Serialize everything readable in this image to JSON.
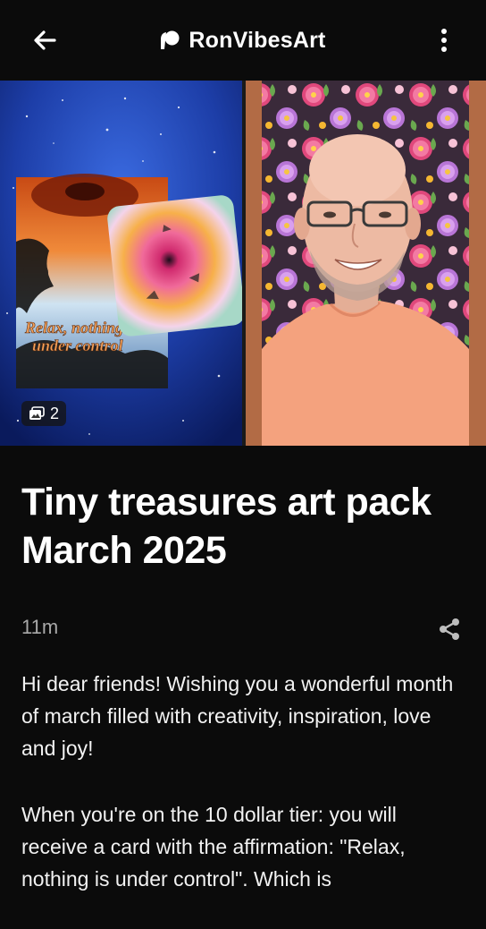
{
  "header": {
    "back_icon": "arrow-left-icon",
    "brand_icon": "patreon-logo-icon",
    "brand_name": "RonVibesArt",
    "more_icon": "more-vertical-icon"
  },
  "gallery": {
    "image_count": "2",
    "count_icon": "images-icon",
    "card_caption": "Relax, nothing is under control"
  },
  "post": {
    "title": "Tiny treasures art pack March 2025",
    "time": "11m",
    "share_icon": "share-icon",
    "paragraphs": [
      "Hi dear friends! Wishing you a wonderful month of march filled with creativity, inspiration, love and joy!",
      "When you're on the 10 dollar tier: you will receive a card with the affirmation: \"Relax, nothing is under control\". Which is"
    ]
  },
  "colors": {
    "background": "#0b0b0b",
    "text_primary": "#ffffff",
    "text_secondary": "#a9a9a9",
    "shirt": "#f4a27e",
    "galaxy": "#1d3ea8"
  }
}
